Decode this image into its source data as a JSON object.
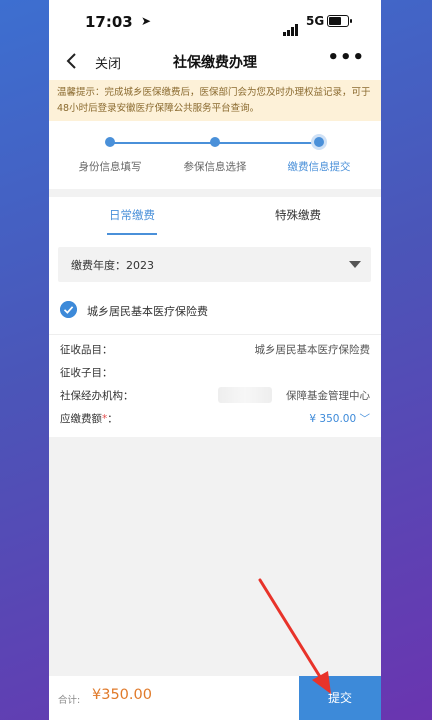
{
  "status_bar": {
    "time": "17:03",
    "network": "5G"
  },
  "nav": {
    "close_label": "关闭",
    "title": "社保缴费办理",
    "more_label": "•••"
  },
  "notice": {
    "text": "温馨提示：完成城乡医保缴费后，医保部门会为您及时办理权益记录，可于48小时后登录安徽医疗保障公共服务平台查询。"
  },
  "steps": [
    {
      "label": "身份信息填写"
    },
    {
      "label": "参保信息选择"
    },
    {
      "label": "缴费信息提交"
    }
  ],
  "tabs": [
    {
      "label": "日常缴费"
    },
    {
      "label": "特殊缴费"
    }
  ],
  "form": {
    "year_label": "缴费年度：2023",
    "insurance_type": "城乡居民基本医疗保险费",
    "rows": [
      {
        "key": "征收品目：",
        "value": "城乡居民基本医疗保险费"
      },
      {
        "key": "征收子目：",
        "value": ""
      },
      {
        "key": "社保经办机构：",
        "value": "保障基金管理中心"
      },
      {
        "key": "应缴费额",
        "required_mark": "*",
        "colon": "：",
        "value": "¥ 350.00"
      }
    ]
  },
  "footer": {
    "total_label": "合计:",
    "total_amount": "¥350.00",
    "submit_label": "提交"
  },
  "colors": {
    "accent": "#3d8ad9",
    "amount": "#e07a2a",
    "notice_bg": "#fdf1d8",
    "arrow": "#e8332a"
  }
}
